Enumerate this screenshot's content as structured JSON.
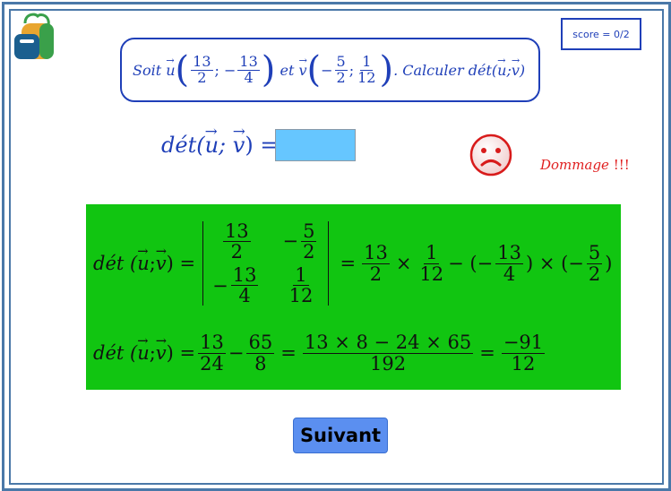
{
  "app": {
    "score": "score = 0/2"
  },
  "question": {
    "prefix": "Soit",
    "u_name": "u",
    "u_x_num": "13",
    "u_x_den": "2",
    "sep1": "; −",
    "u_y_num": "13",
    "u_y_den": "4",
    "et": "et",
    "v_name": "v",
    "v_minus": "−",
    "v_x_num": "5",
    "v_x_den": "2",
    "sep2": ";",
    "v_y_num": "1",
    "v_y_den": "12",
    "suffix": ". Calculer dét(",
    "suffix_u": "u",
    "suffix_sep": "; ",
    "suffix_v": "v",
    "suffix_end": ")"
  },
  "answer": {
    "label_prefix": "dét(",
    "label_u": "u",
    "label_sep": "; ",
    "label_v": "v",
    "label_end": ") =",
    "value": ""
  },
  "feedback": {
    "icon": "sad-face-icon",
    "message": "Dommage",
    "bang": "!!!"
  },
  "solution": {
    "det_prefix": "dét (",
    "u": "u",
    "sep": "; ",
    "v": "v",
    "det_end": ") =",
    "m11_num": "13",
    "m11_den": "2",
    "m12_sign": "−",
    "m12_num": "5",
    "m12_den": "2",
    "m21_sign": "−",
    "m21_num": "13",
    "m21_den": "4",
    "m22_num": "1",
    "m22_den": "12",
    "eq": "=",
    "t1_num": "13",
    "t1_den": "2",
    "times": "×",
    "t2_num": "1",
    "t2_den": "12",
    "minus_open": "− (−",
    "t3_num": "13",
    "t3_den": "4",
    "close_times_open": ") × (−",
    "t4_num": "5",
    "t4_den": "2",
    "close": ")",
    "r2_a_num": "13",
    "r2_a_den": "24",
    "r2_minus": "−",
    "r2_b_num": "65",
    "r2_b_den": "8",
    "r2_eq1": "=",
    "r2_c_num": "13 × 8 − 24 × 65",
    "r2_c_den": "192",
    "r2_eq2": "=",
    "r2_d_num": "−91",
    "r2_d_den": "12"
  },
  "buttons": {
    "next": "Suivant"
  },
  "colors": {
    "accent": "#1f3fb8",
    "frame": "#4a78a8",
    "input": "#66c6ff",
    "solution_bg": "#11c511",
    "error": "#e02020",
    "button": "#5b8ff0"
  }
}
